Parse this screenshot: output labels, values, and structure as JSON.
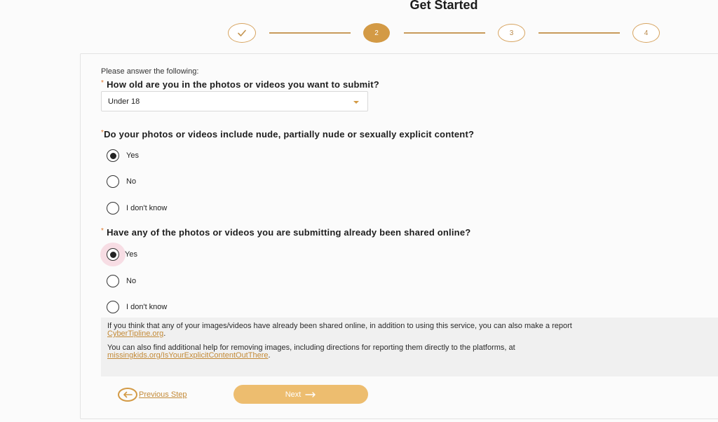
{
  "header": {
    "title": "Get Started"
  },
  "stepper": {
    "steps": [
      {
        "label": "",
        "state": "done",
        "icon": "check-icon"
      },
      {
        "label": "2",
        "state": "active"
      },
      {
        "label": "3",
        "state": "pending"
      },
      {
        "label": "4",
        "state": "pending"
      }
    ]
  },
  "form": {
    "intro": "Please answer the following:",
    "q1": {
      "required": "*",
      "text": "How old are you in the photos or videos you want to submit?",
      "selected": "Under 18"
    },
    "q2": {
      "required": "*",
      "text": "Do your photos or videos include nude, partially nude or sexually explicit content?",
      "options": [
        "Yes",
        "No",
        "I don't know"
      ],
      "selected": "Yes"
    },
    "q3": {
      "required": "*",
      "text": "Have any of the photos or videos you are submitting already been shared online?",
      "options": [
        "Yes",
        "No",
        "I don't know"
      ],
      "selected": "Yes"
    }
  },
  "info": {
    "p1_text": "If you think that any of your images/videos have already been shared online, in addition to using this service, you can also make a report",
    "p1_link": "CyberTipline.org",
    "p1_end": ".",
    "p2_text": "You can also find additional help for removing images, including directions for reporting them directly to the platforms, at",
    "p2_link": "missingkids.org/IsYourExplicitContentOutThere",
    "p2_end": "."
  },
  "actions": {
    "previous_label": "Previous Step",
    "next_label": "Next"
  },
  "colors": {
    "accent": "#d39a45",
    "next_button": "#edbd6f",
    "link": "#c38a37",
    "focus_ring": "#f7dde4"
  }
}
